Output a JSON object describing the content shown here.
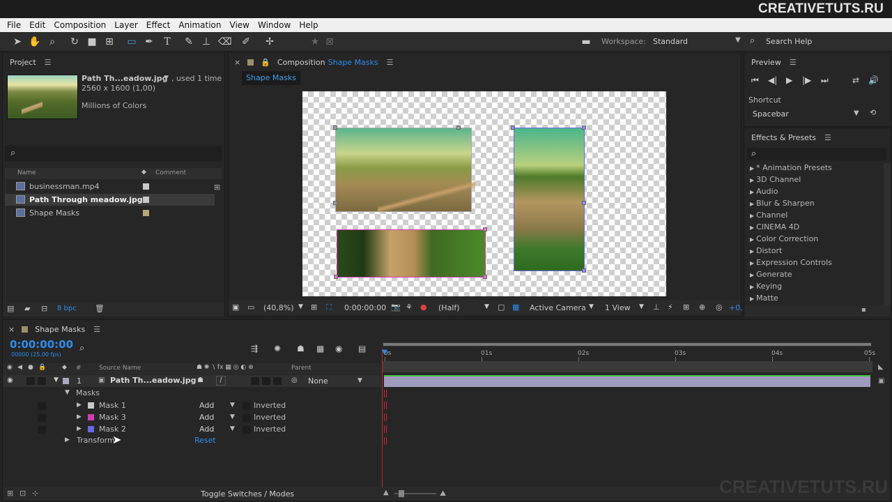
{
  "brand": "CREATIVETUTS.RU",
  "watermark": "CREATIVETUTS.RU",
  "menu": [
    "File",
    "Edit",
    "Composition",
    "Layer",
    "Effect",
    "Animation",
    "View",
    "Window",
    "Help"
  ],
  "toolbar": {
    "workspace_label": "Workspace:",
    "workspace_value": "Standard",
    "search_label": "Search Help"
  },
  "project": {
    "title": "Project",
    "file_name": "Path Th...eadow.jpg",
    "used": ", used 1 time",
    "dims": "2560 x 1600 (1,00)",
    "colors": "Millions of Colors",
    "col_name": "Name",
    "col_comment": "Comment",
    "items": [
      {
        "name": "businessman.mp4",
        "icon": "video-file-icon",
        "color": "#c8c8c8"
      },
      {
        "name": "Path Through meadow.jpg",
        "icon": "image-file-icon",
        "color": "#c8c8c8"
      },
      {
        "name": "Shape Masks",
        "icon": "composition-icon",
        "color": "#b4a878"
      }
    ],
    "bpc": "8 bpc"
  },
  "composition": {
    "label": "Composition",
    "name": "Shape Masks",
    "tab": "Shape Masks",
    "zoom": "(40,8%)",
    "timecode": "0:00:00:00",
    "resolution": "(Half)",
    "camera": "Active Camera",
    "view": "1 View",
    "exposure": "+0,"
  },
  "preview": {
    "title": "Preview",
    "shortcut_label": "Shortcut",
    "shortcut_value": "Spacebar"
  },
  "effects": {
    "title": "Effects & Presets",
    "items": [
      "* Animation Presets",
      "3D Channel",
      "Audio",
      "Blur & Sharpen",
      "Channel",
      "CINEMA 4D",
      "Color Correction",
      "Distort",
      "Expression Controls",
      "Generate",
      "Keying",
      "Matte"
    ]
  },
  "timeline": {
    "tab": "Shape Masks",
    "timecode": "0:00:00:00",
    "fps": "00000 (25.00 fps)",
    "col_source": "Source Name",
    "col_parent": "Parent",
    "layer_num": "1",
    "layer_name": "Path Th...eadow.jpg",
    "parent_value": "None",
    "masks_label": "Masks",
    "masks": [
      {
        "name": "Mask 1",
        "mode": "Add",
        "inverted": "Inverted",
        "color": "#c8c8c8"
      },
      {
        "name": "Mask 3",
        "mode": "Add",
        "inverted": "Inverted",
        "color": "#d23cb4"
      },
      {
        "name": "Mask 2",
        "mode": "Add",
        "inverted": "Inverted",
        "color": "#6a6ae0"
      }
    ],
    "transform_label": "Transform",
    "reset_label": "Reset",
    "ruler": [
      "0s",
      "01s",
      "02s",
      "03s",
      "04s",
      "05s"
    ],
    "toggle_label": "Toggle Switches / Modes"
  }
}
